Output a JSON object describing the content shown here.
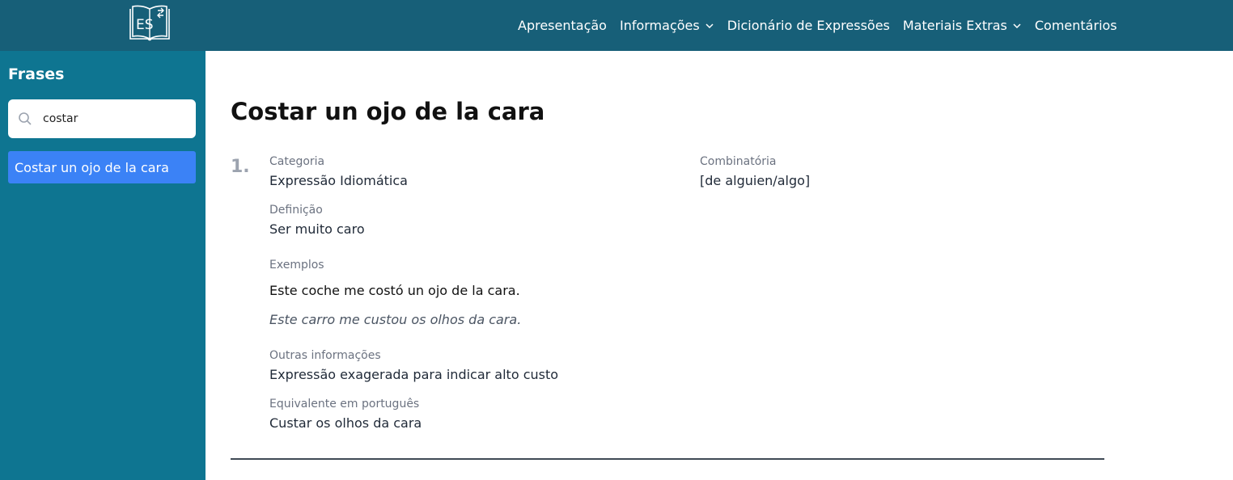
{
  "header": {
    "logo_icon": "open-book-es-logo",
    "logo_text": "ES",
    "nav": [
      {
        "label": "Apresentação",
        "dropdown": false
      },
      {
        "label": "Informações",
        "dropdown": true
      },
      {
        "label": "Dicionário de Expressões",
        "dropdown": false
      },
      {
        "label": "Materiais Extras",
        "dropdown": true
      },
      {
        "label": "Comentários",
        "dropdown": false
      }
    ]
  },
  "sidebar": {
    "title": "Frases",
    "search": {
      "value": "costar",
      "icon": "search-icon"
    },
    "results": [
      {
        "label": "Costar un ojo de la cara",
        "active": true
      }
    ]
  },
  "entry": {
    "title": "Costar un ojo de la cara",
    "number": "1.",
    "categoria_label": "Categoria",
    "categoria_value": "Expressão Idiomática",
    "combinatoria_label": "Combinatória",
    "combinatoria_value": "[de alguien/algo]",
    "definicao_label": "Definição",
    "definicao_value": "Ser muito caro",
    "exemplos_label": "Exemplos",
    "exemplo_es": "Este coche me costó un ojo de la cara.",
    "exemplo_pt": "Este carro me custou os olhos da cara.",
    "outras_label": "Outras informações",
    "outras_value": "Expressão exagerada para indicar alto custo",
    "equivalente_label": "Equivalente em português",
    "equivalente_value": "Custar os olhos da cara"
  },
  "colors": {
    "header_bg": "#175f78",
    "sidebar_bg": "#0e7591",
    "active_item": "#3b82f6"
  }
}
